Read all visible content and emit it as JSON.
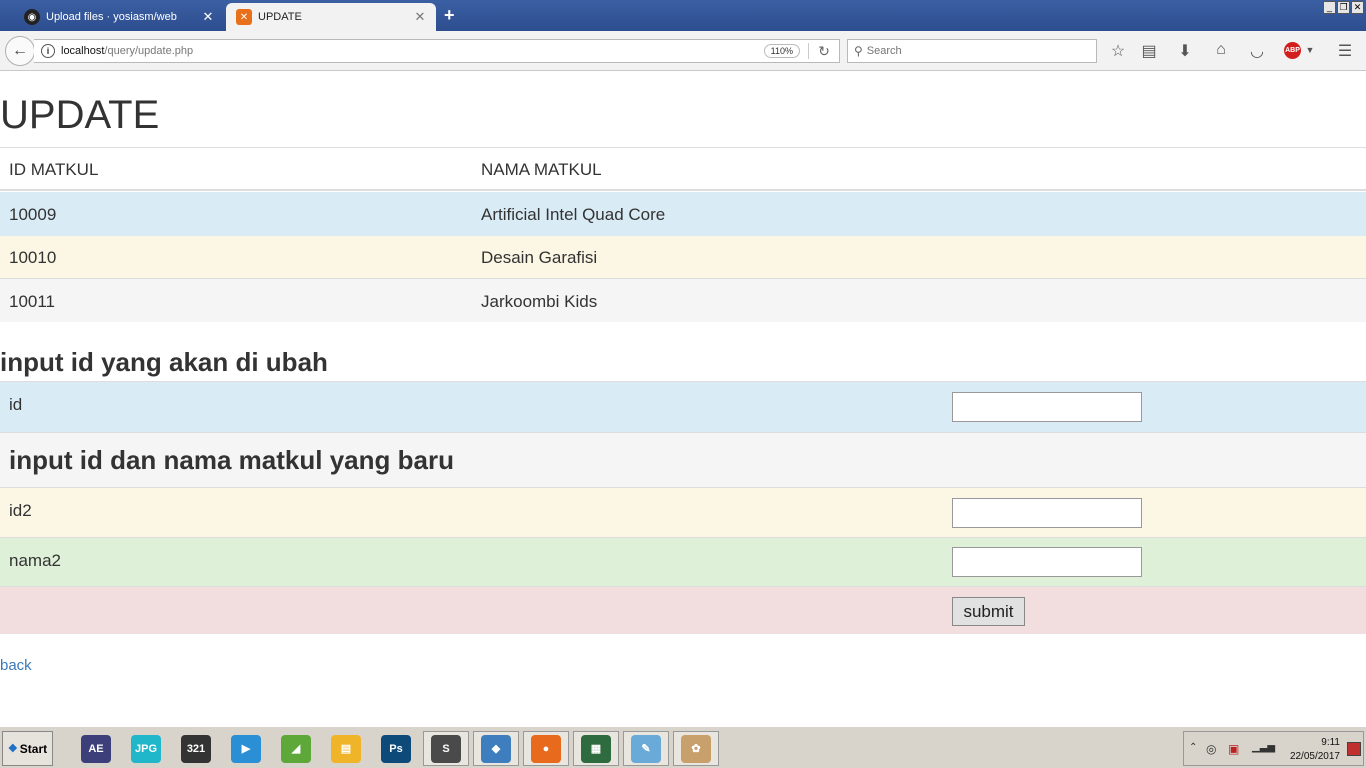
{
  "browser": {
    "tabs": [
      {
        "label": "Upload files · yosiasm/web",
        "active": false,
        "icon": "github-icon"
      },
      {
        "label": "UPDATE",
        "active": true,
        "icon": "xampp-icon"
      }
    ],
    "url_host": "localhost",
    "url_path": "/query/update.php",
    "zoom": "110%",
    "search_placeholder": "Search"
  },
  "page": {
    "title": "UPDATE",
    "table": {
      "headers": [
        "ID MATKUL",
        "NAMA MATKUL"
      ],
      "rows": [
        [
          "10009",
          "Artificial Intel Quad Core"
        ],
        [
          "10010",
          "Desain Garafisi"
        ],
        [
          "10011",
          "Jarkoombi Kids"
        ]
      ]
    },
    "form": {
      "heading1": "input id yang akan di ubah",
      "id_label": "id",
      "heading2": "input id dan nama matkul yang baru",
      "id2_label": "id2",
      "nama2_label": "nama2",
      "submit_label": "submit"
    },
    "back_link": "back"
  },
  "taskbar": {
    "start_label": "Start",
    "apps": [
      {
        "name": "after-effects",
        "label": "AE",
        "color": "#3c3f7a"
      },
      {
        "name": "jpg-viewer",
        "label": "JPG",
        "color": "#1fb7c9"
      },
      {
        "name": "media-player-classic",
        "label": "321",
        "color": "#333333"
      },
      {
        "name": "media-player",
        "label": "▶",
        "color": "#2a8fd4"
      },
      {
        "name": "fl-studio",
        "label": "◢",
        "color": "#5ea83a"
      },
      {
        "name": "file-explorer",
        "label": "▤",
        "color": "#f0b429"
      },
      {
        "name": "photoshop",
        "label": "Ps",
        "color": "#0d4a7a"
      },
      {
        "name": "sublime-text",
        "label": "S",
        "color": "#4a4a4a"
      },
      {
        "name": "virtualbox",
        "label": "◆",
        "color": "#3e7ebf"
      },
      {
        "name": "firefox",
        "label": "●",
        "color": "#e86a1c"
      },
      {
        "name": "task-manager",
        "label": "▦",
        "color": "#2e6b3f"
      },
      {
        "name": "notepad",
        "label": "✎",
        "color": "#6aaad8"
      },
      {
        "name": "paint",
        "label": "✿",
        "color": "#c7a06b"
      }
    ],
    "clock_time": "9:11",
    "clock_date": "22/05/2017"
  }
}
